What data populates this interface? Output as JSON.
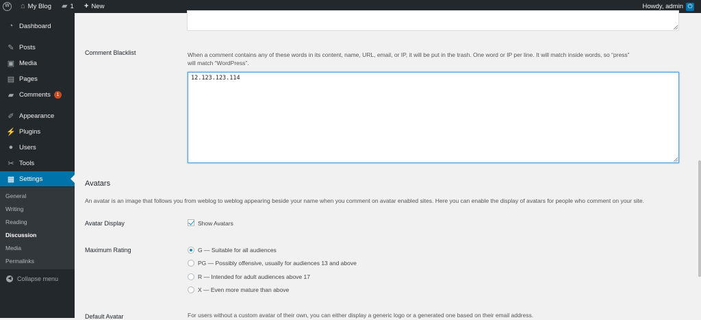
{
  "adminbar": {
    "site_name": "My Blog",
    "comments_count": "1",
    "new_label": "New",
    "howdy": "Howdy, admin"
  },
  "sidebar": {
    "items": [
      {
        "label": "Dashboard",
        "icon": "dashboard-icon"
      },
      {
        "label": "Posts",
        "icon": "pin-icon"
      },
      {
        "label": "Media",
        "icon": "media-icon"
      },
      {
        "label": "Pages",
        "icon": "pages-icon"
      },
      {
        "label": "Comments",
        "icon": "comments-icon",
        "badge": "1"
      },
      {
        "label": "Appearance",
        "icon": "brush-icon"
      },
      {
        "label": "Plugins",
        "icon": "plugin-icon"
      },
      {
        "label": "Users",
        "icon": "users-icon"
      },
      {
        "label": "Tools",
        "icon": "wrench-icon"
      },
      {
        "label": "Settings",
        "icon": "settings-icon"
      }
    ],
    "submenu": [
      "General",
      "Writing",
      "Reading",
      "Discussion",
      "Media",
      "Permalinks"
    ],
    "collapse_label": "Collapse menu"
  },
  "content": {
    "blacklist": {
      "label": "Comment Blacklist",
      "description_line1": "When a comment contains any of these words in its content, name, URL, email, or IP, it will be put in the trash. One word or IP per line. It will match inside words, so “press”",
      "description_line2": "will match “WordPress”.",
      "value": "12.123.123.114"
    },
    "avatars": {
      "title": "Avatars",
      "description": "An avatar is an image that follows you from weblog to weblog appearing beside your name when you comment on avatar enabled sites. Here you can enable the display of avatars for people who comment on your site.",
      "display_label": "Avatar Display",
      "show_avatars": "Show Avatars",
      "show_avatars_checked": true,
      "rating_label": "Maximum Rating",
      "ratings": [
        "G — Suitable for all audiences",
        "PG — Possibly offensive, usually for audiences 13 and above",
        "R — Intended for adult audiences above 17",
        "X — Even more mature than above"
      ],
      "selected_rating": 0,
      "default_label": "Default Avatar",
      "default_description": "For users without a custom avatar of their own, you can either display a generic logo or a generated one based on their email address."
    }
  },
  "colors": {
    "adminbar_bg": "#23282d",
    "accent": "#0073aa",
    "badge": "#ca4a1f",
    "page_bg": "#f1f1f1"
  }
}
